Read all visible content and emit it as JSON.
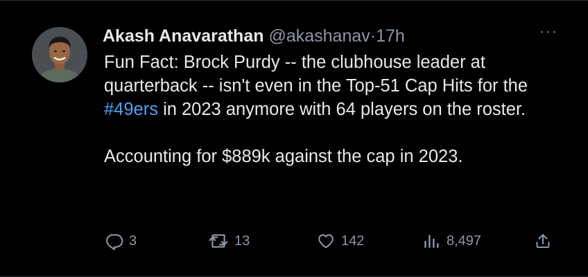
{
  "tweet": {
    "author_name": "Akash Anavarathan",
    "author_handle": "@akashanav",
    "separator": "·",
    "time": "17h",
    "more_label": "···",
    "text_part1": "Fun Fact: Brock Purdy -- the clubhouse leader at quarterback -- isn't even in the Top-51 Cap Hits for the ",
    "hashtag": "#49ers",
    "text_part2": " in 2023 anymore with 64 players on the roster.",
    "text_paragraph2": "Accounting for $889k against the cap in 2023.",
    "hashtag_color": "#4ea1f2"
  },
  "actions": {
    "replies": "3",
    "reposts": "13",
    "likes": "142",
    "views": "8,497"
  },
  "icons": [
    "reply-icon",
    "repost-icon",
    "like-icon",
    "views-icon",
    "share-icon",
    "more-icon"
  ]
}
